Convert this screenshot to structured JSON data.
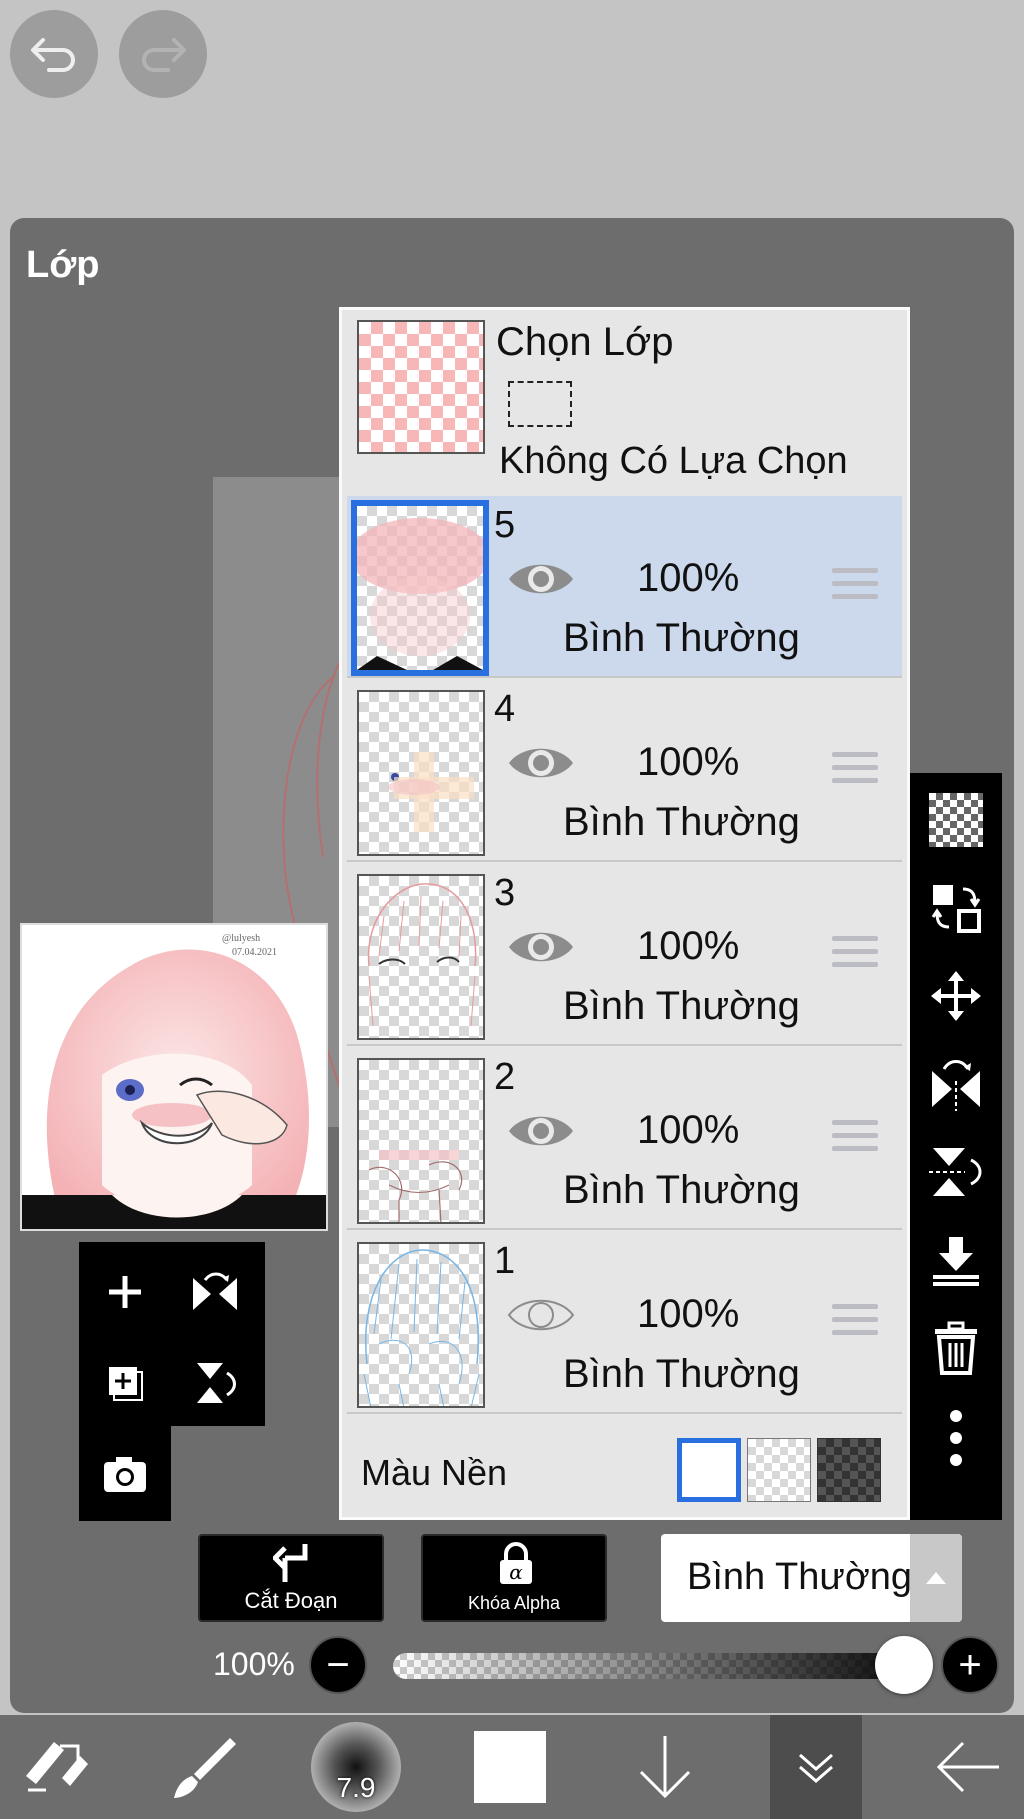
{
  "top": {
    "undo_icon": "undo-icon",
    "redo_icon": "redo-icon"
  },
  "panel": {
    "title": "Lớp"
  },
  "preview_watermark": [
    "@lulyesh",
    "07.04.2021"
  ],
  "selection_layer": {
    "title": "Chọn Lớp",
    "subtitle": "Không Có Lựa Chọn"
  },
  "layers": [
    {
      "number": "5",
      "opacity": "100%",
      "mode": "Bình Thường",
      "visible": true,
      "selected": true
    },
    {
      "number": "4",
      "opacity": "100%",
      "mode": "Bình Thường",
      "visible": true,
      "selected": false
    },
    {
      "number": "3",
      "opacity": "100%",
      "mode": "Bình Thường",
      "visible": true,
      "selected": false
    },
    {
      "number": "2",
      "opacity": "100%",
      "mode": "Bình Thường",
      "visible": true,
      "selected": false
    },
    {
      "number": "1",
      "opacity": "100%",
      "mode": "Bình Thường",
      "visible": false,
      "selected": false
    }
  ],
  "background_color": {
    "label": "Màu Nền",
    "options": [
      "white",
      "transparent",
      "dark"
    ],
    "selected": "white"
  },
  "actions": {
    "clipping_label": "Cắt Đoạn",
    "alpha_lock_label": "Khóa Alpha"
  },
  "blend_mode": {
    "value": "Bình Thường"
  },
  "opacity": {
    "label": "100%",
    "value": 100,
    "minus": "−",
    "plus": "+"
  },
  "brush": {
    "size": "7.9"
  },
  "colors": {
    "accent": "#2a6fe0",
    "selected_row": "#ccd8ec",
    "panel_bg": "#6d6d6d",
    "toolbar_bg": "#000000"
  }
}
